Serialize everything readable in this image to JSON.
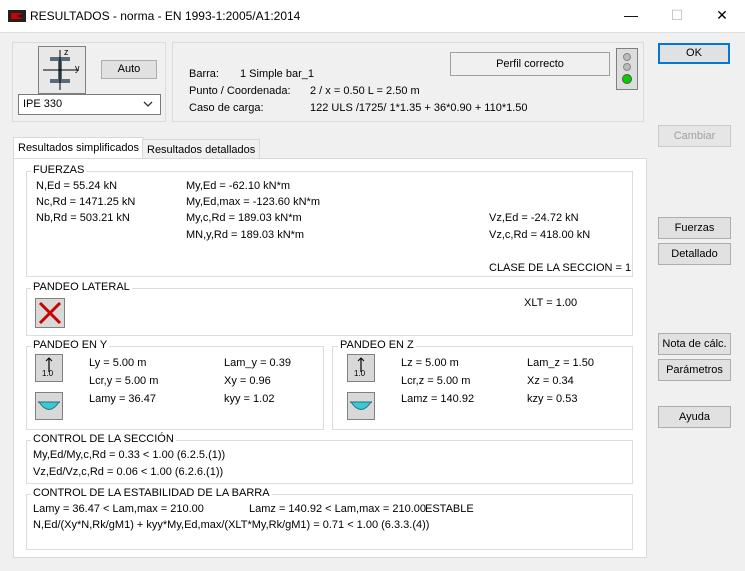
{
  "window": {
    "title": "RESULTADOS - norma - EN 1993-1:2005/A1:2014",
    "minimize": "—",
    "maximize": "☐",
    "close": "✕"
  },
  "profile": {
    "auto_label": "Auto",
    "section": "IPE 330",
    "axis_z": "z",
    "axis_y": "y"
  },
  "info": {
    "barra_label": "Barra:",
    "barra_value": "1  Simple bar_1",
    "punto_label": "Punto / Coordenada:",
    "punto_value": "2 / x = 0.50 L = 2.50 m",
    "caso_label": "Caso de carga:",
    "caso_value": "122 ULS /1725/  1*1.35 + 36*0.90 + 110*1.50",
    "status": "Perfil correcto"
  },
  "buttons": {
    "ok": "OK",
    "cambiar": "Cambiar",
    "fuerzas": "Fuerzas",
    "detallado": "Detallado",
    "nota": "Nota de cálc.",
    "parametros": "Parámetros",
    "ayuda": "Ayuda"
  },
  "tabs": {
    "simplified": "Resultados simplificados",
    "detailed": "Resultados detallados"
  },
  "fuerzas": {
    "title": "FUERZAS",
    "n_ed": "N,Ed = 55.24 kN",
    "nc_rd": "Nc,Rd = 1471.25 kN",
    "nb_rd": "Nb,Rd = 503.21 kN",
    "my_ed": "My,Ed = -62.10 kN*m",
    "my_ed_max": "My,Ed,max = -123.60 kN*m",
    "my_c_rd": "My,c,Rd = 189.03 kN*m",
    "mn_y_rd": "MN,y,Rd = 189.03 kN*m",
    "vz_ed": "Vz,Ed = -24.72 kN",
    "vz_c_rd": "Vz,c,Rd = 418.00 kN",
    "clase": "CLASE DE LA SECCION = 1"
  },
  "pandeo_lateral": {
    "title": "PANDEO LATERAL",
    "xlt": "XLT = 1.00"
  },
  "pandeo_y": {
    "title": "PANDEO EN Y",
    "icon_label": "1.0",
    "ly": "Ly = 5.00 m",
    "lcr": "Lcr,y = 5.00 m",
    "lam": "Lamy = 36.47",
    "lam_rel": "Lam_y = 0.39",
    "x": "Xy = 0.96",
    "k": "kyy = 1.02"
  },
  "pandeo_z": {
    "title": "PANDEO EN Z",
    "icon_label": "1.0",
    "lz": "Lz = 5.00 m",
    "lcr": "Lcr,z = 5.00 m",
    "lam": "Lamz = 140.92",
    "lam_rel": "Lam_z = 1.50",
    "x": "Xz = 0.34",
    "k": "kzy = 0.53"
  },
  "control_seccion": {
    "title": "CONTROL DE LA SECCIÓN",
    "line1": "My,Ed/My,c,Rd = 0.33 < 1.00   (6.2.5.(1))",
    "line2": "Vz,Ed/Vz,c,Rd = 0.06 < 1.00   (6.2.6.(1))"
  },
  "control_estabilidad": {
    "title": "CONTROL DE LA ESTABILIDAD DE LA BARRA",
    "lamy": "Lamy = 36.47 < Lam,max = 210.00",
    "lamz": "Lamz = 140.92 < Lam,max = 210.00",
    "estable": "ESTABLE",
    "formula": "N,Ed/(Xy*N,Rk/gM1) + kyy*My,Ed,max/(XLT*My,Rk/gM1) = 0.71 < 1.00   (6.3.3.(4))"
  },
  "colors": {
    "accent": "#0078d7",
    "icon_red": "#cc0000",
    "light_green": "#00d000",
    "cyan": "#40c8d0"
  }
}
